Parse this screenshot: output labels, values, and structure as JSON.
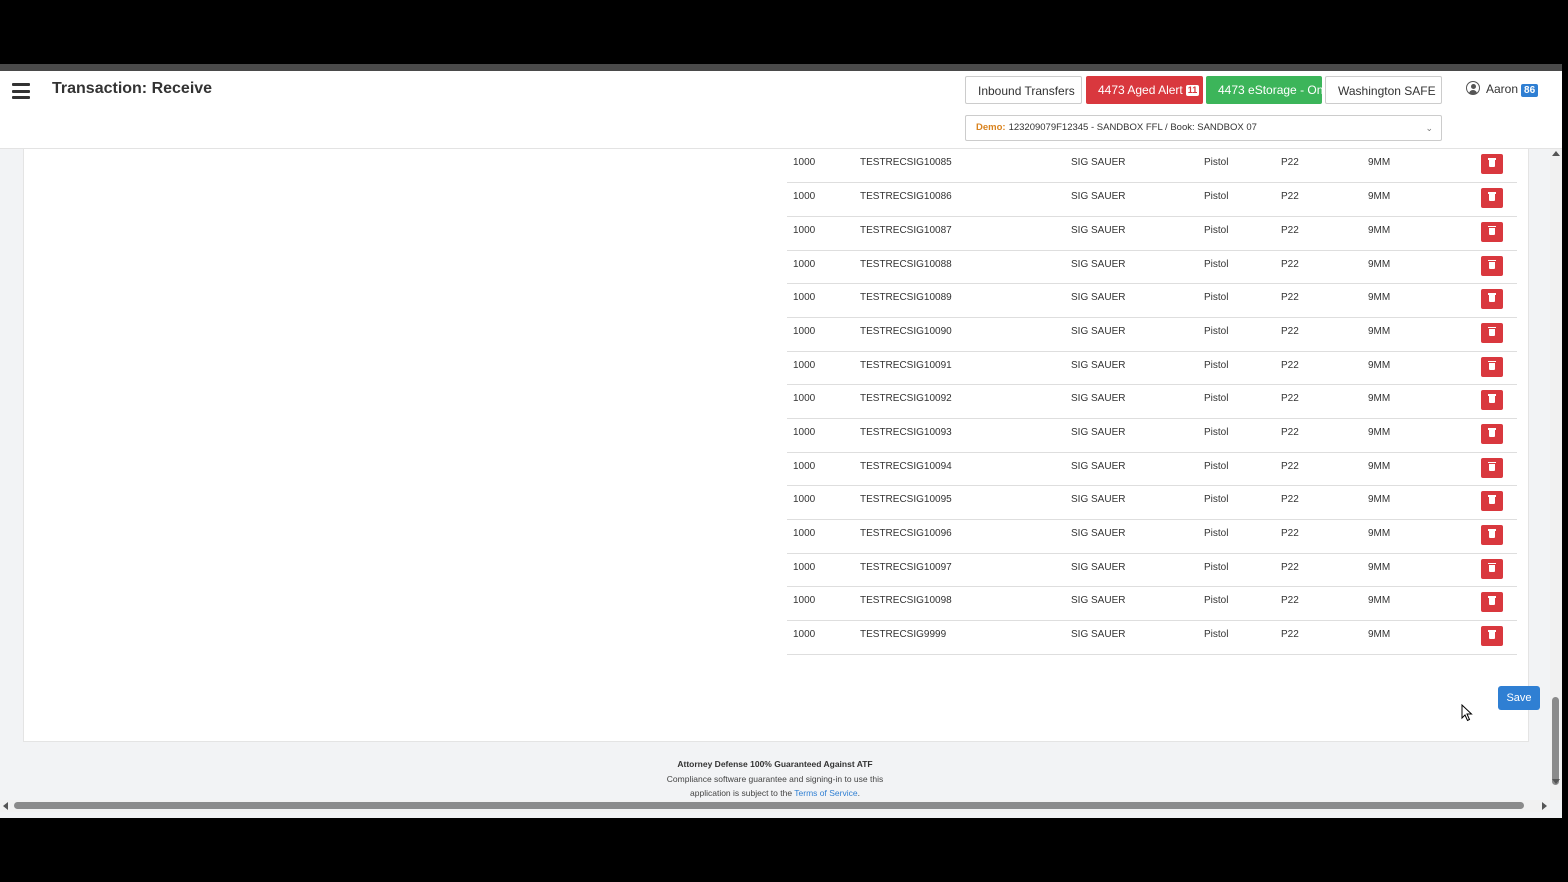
{
  "header": {
    "title": "Transaction: Receive",
    "buttons": {
      "inbound": "Inbound Transfers",
      "aged_alert": "4473 Aged Alert",
      "aged_alert_count": "11",
      "estorage": "4473 eStorage - On",
      "washington": "Washington SAFE"
    },
    "user": {
      "name": "Aaron",
      "badge": "86"
    },
    "book_select": {
      "prefix": "Demo:",
      "value": "123209079F12345 - SANDBOX FFL / Book: SANDBOX 07"
    }
  },
  "table": {
    "rows": [
      [
        "1000",
        "TESTRECSIG10085",
        "SIG SAUER",
        "Pistol",
        "P22",
        "9MM"
      ],
      [
        "1000",
        "TESTRECSIG10086",
        "SIG SAUER",
        "Pistol",
        "P22",
        "9MM"
      ],
      [
        "1000",
        "TESTRECSIG10087",
        "SIG SAUER",
        "Pistol",
        "P22",
        "9MM"
      ],
      [
        "1000",
        "TESTRECSIG10088",
        "SIG SAUER",
        "Pistol",
        "P22",
        "9MM"
      ],
      [
        "1000",
        "TESTRECSIG10089",
        "SIG SAUER",
        "Pistol",
        "P22",
        "9MM"
      ],
      [
        "1000",
        "TESTRECSIG10090",
        "SIG SAUER",
        "Pistol",
        "P22",
        "9MM"
      ],
      [
        "1000",
        "TESTRECSIG10091",
        "SIG SAUER",
        "Pistol",
        "P22",
        "9MM"
      ],
      [
        "1000",
        "TESTRECSIG10092",
        "SIG SAUER",
        "Pistol",
        "P22",
        "9MM"
      ],
      [
        "1000",
        "TESTRECSIG10093",
        "SIG SAUER",
        "Pistol",
        "P22",
        "9MM"
      ],
      [
        "1000",
        "TESTRECSIG10094",
        "SIG SAUER",
        "Pistol",
        "P22",
        "9MM"
      ],
      [
        "1000",
        "TESTRECSIG10095",
        "SIG SAUER",
        "Pistol",
        "P22",
        "9MM"
      ],
      [
        "1000",
        "TESTRECSIG10096",
        "SIG SAUER",
        "Pistol",
        "P22",
        "9MM"
      ],
      [
        "1000",
        "TESTRECSIG10097",
        "SIG SAUER",
        "Pistol",
        "P22",
        "9MM"
      ],
      [
        "1000",
        "TESTRECSIG10098",
        "SIG SAUER",
        "Pistol",
        "P22",
        "9MM"
      ],
      [
        "1000",
        "TESTRECSIG9999",
        "SIG SAUER",
        "Pistol",
        "P22",
        "9MM"
      ]
    ],
    "row_action_icon": "trash-icon"
  },
  "save_label": "Save",
  "footer": {
    "title": "Attorney Defense 100% Guaranteed Against ATF",
    "line1": "Compliance software guarantee and signing-in to use this",
    "line2_prefix": "application is subject to the ",
    "terms_link": "Terms of Service",
    "line2_suffix": "."
  },
  "colors": {
    "danger": "#d9383e",
    "success": "#3cb55a",
    "primary": "#2f7fd3",
    "demo_label": "#d9831f"
  }
}
